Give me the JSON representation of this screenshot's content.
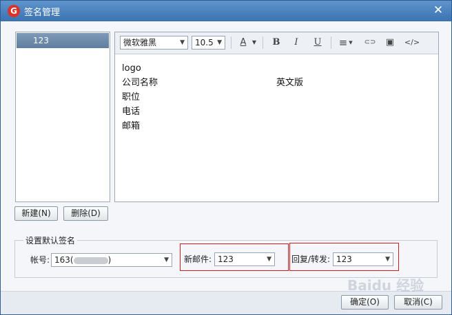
{
  "window": {
    "title": "签名管理",
    "app_logo_letter": "G",
    "close_glyph": "✕"
  },
  "signature_list": {
    "items": [
      {
        "label": "123"
      }
    ]
  },
  "toolbar": {
    "font_family": "微软雅黑",
    "font_size": "10.5",
    "font_color_glyph": "A",
    "bold_glyph": "B",
    "italic_glyph": "I",
    "underline_glyph": "U",
    "align_glyph": "≡",
    "link_glyph": "⊂⊃",
    "image_glyph": "▣",
    "source_glyph": "</>",
    "dropdown_glyph": "▼"
  },
  "editor": {
    "lines": [
      {
        "left": "logo",
        "right": ""
      },
      {
        "left": "公司名称",
        "right": "英文版"
      },
      {
        "left": "职位",
        "right": ""
      },
      {
        "left": "电话",
        "right": ""
      },
      {
        "left": "邮箱",
        "right": ""
      }
    ]
  },
  "actions": {
    "new_label": "新建(N)",
    "delete_label": "删除(D)"
  },
  "default_signature": {
    "group_title": "设置默认签名",
    "account_label": "帐号:",
    "account_value": "163(",
    "account_value_suffix": ")",
    "new_mail_label": "新邮件:",
    "new_mail_value": "123",
    "reply_label": "回复/转发:",
    "reply_value": "123"
  },
  "footer": {
    "ok_label": "确定(O)",
    "cancel_label": "取消(C)"
  },
  "watermark": {
    "text": "Baidu 经验"
  },
  "colors": {
    "title_bar": "#3b72b1",
    "highlight": "#d21b1b",
    "selection": "#6d88a8"
  }
}
